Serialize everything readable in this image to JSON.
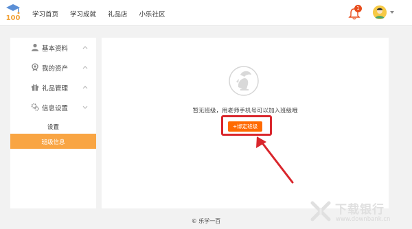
{
  "header": {
    "logo_text": "100",
    "nav": [
      "学习首页",
      "学习成就",
      "礼品店",
      "小乐社区"
    ],
    "notification_count": "1"
  },
  "sidebar": {
    "items": [
      {
        "label": "基本资料",
        "icon": "user-icon"
      },
      {
        "label": "我的资产",
        "icon": "asset-icon"
      },
      {
        "label": "礼品管理",
        "icon": "gift-icon"
      },
      {
        "label": "信息设置",
        "icon": "settings-icon"
      }
    ],
    "subitems": [
      {
        "label": "设置",
        "active": false
      },
      {
        "label": "班级信息",
        "active": true
      }
    ]
  },
  "main": {
    "empty_message": "暂无班级，用老师手机号可以加入班级哦",
    "bind_button": "+绑定班级"
  },
  "footer": {
    "text": "乐学一百"
  },
  "watermark": {
    "title": "下载银行",
    "url": "www.downbank.cn"
  },
  "colors": {
    "accent": "#ff6a00",
    "active_tab": "#f9a543",
    "annotation": "#d9262c"
  }
}
